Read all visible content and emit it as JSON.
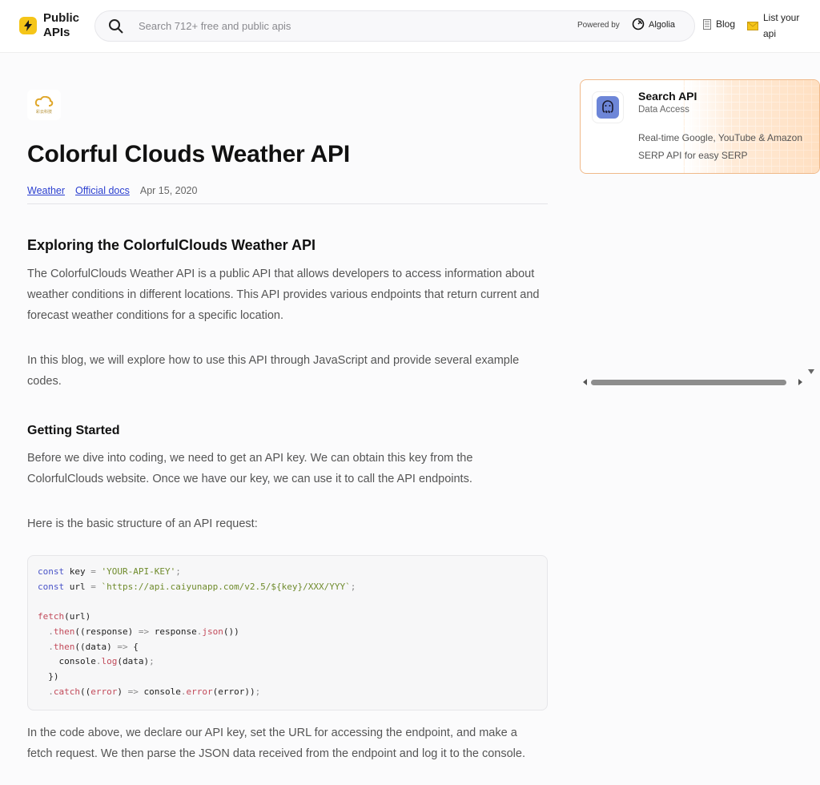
{
  "header": {
    "logo_text": "Public APIs",
    "search_placeholder": "Search 712+ free and public apis",
    "powered_by": "Powered by",
    "algolia": "Algolia",
    "blog": "Blog",
    "list_api": "List your api"
  },
  "article": {
    "logo_caption": "彩云科技",
    "title": "Colorful Clouds Weather API",
    "category": "Weather",
    "docs_link": "Official docs",
    "date": "Apr 15, 2020",
    "h2": "Exploring the ColorfulClouds Weather API",
    "p1": "The ColorfulClouds Weather API is a public API that allows developers to access information about weather conditions in different locations. This API provides various endpoints that return current and forecast weather conditions for a specific location.",
    "p2": "In this blog, we will explore how to use this API through JavaScript and provide several example codes.",
    "h3": "Getting Started",
    "p3": "Before we dive into coding, we need to get an API key. We can obtain this key from the ColorfulClouds website. Once we have our key, we can use it to call the API endpoints.",
    "p4": "Here is the basic structure of an API request:",
    "p5": "In the code above, we declare our API key, set the URL for accessing the endpoint, and make a fetch request. We then parse the JSON data received from the endpoint and log it to the console."
  },
  "code": {
    "l1_kw": "const",
    "l1_var": "key",
    "l1_str": "'YOUR-API-KEY'",
    "l2_kw": "const",
    "l2_var": "url",
    "l2_str": "`https://api.caiyunapp.com/v2.5/${key}/XXX/YYY`",
    "l3_fn": "fetch",
    "l3_arg": "url",
    "l4_then": "then",
    "l4_param": "response",
    "l4_obj": "response",
    "l4_json": "json",
    "l5_then": "then",
    "l5_param": "data",
    "l6_console": "console",
    "l6_log": "log",
    "l6_arg": "data",
    "l8_catch": "catch",
    "l8_param": "error",
    "l8_console": "console",
    "l8_error": "error",
    "l8_arg": "error"
  },
  "sidebar": {
    "card_title": "Search API",
    "card_sub": "Data Access",
    "card_desc": "Real-time Google, YouTube & Amazon SERP API for easy SERP"
  },
  "colors": {
    "accent_link": "#2b3fd0",
    "logo_yellow": "#f5c518",
    "card_border": "#f0b98a"
  }
}
